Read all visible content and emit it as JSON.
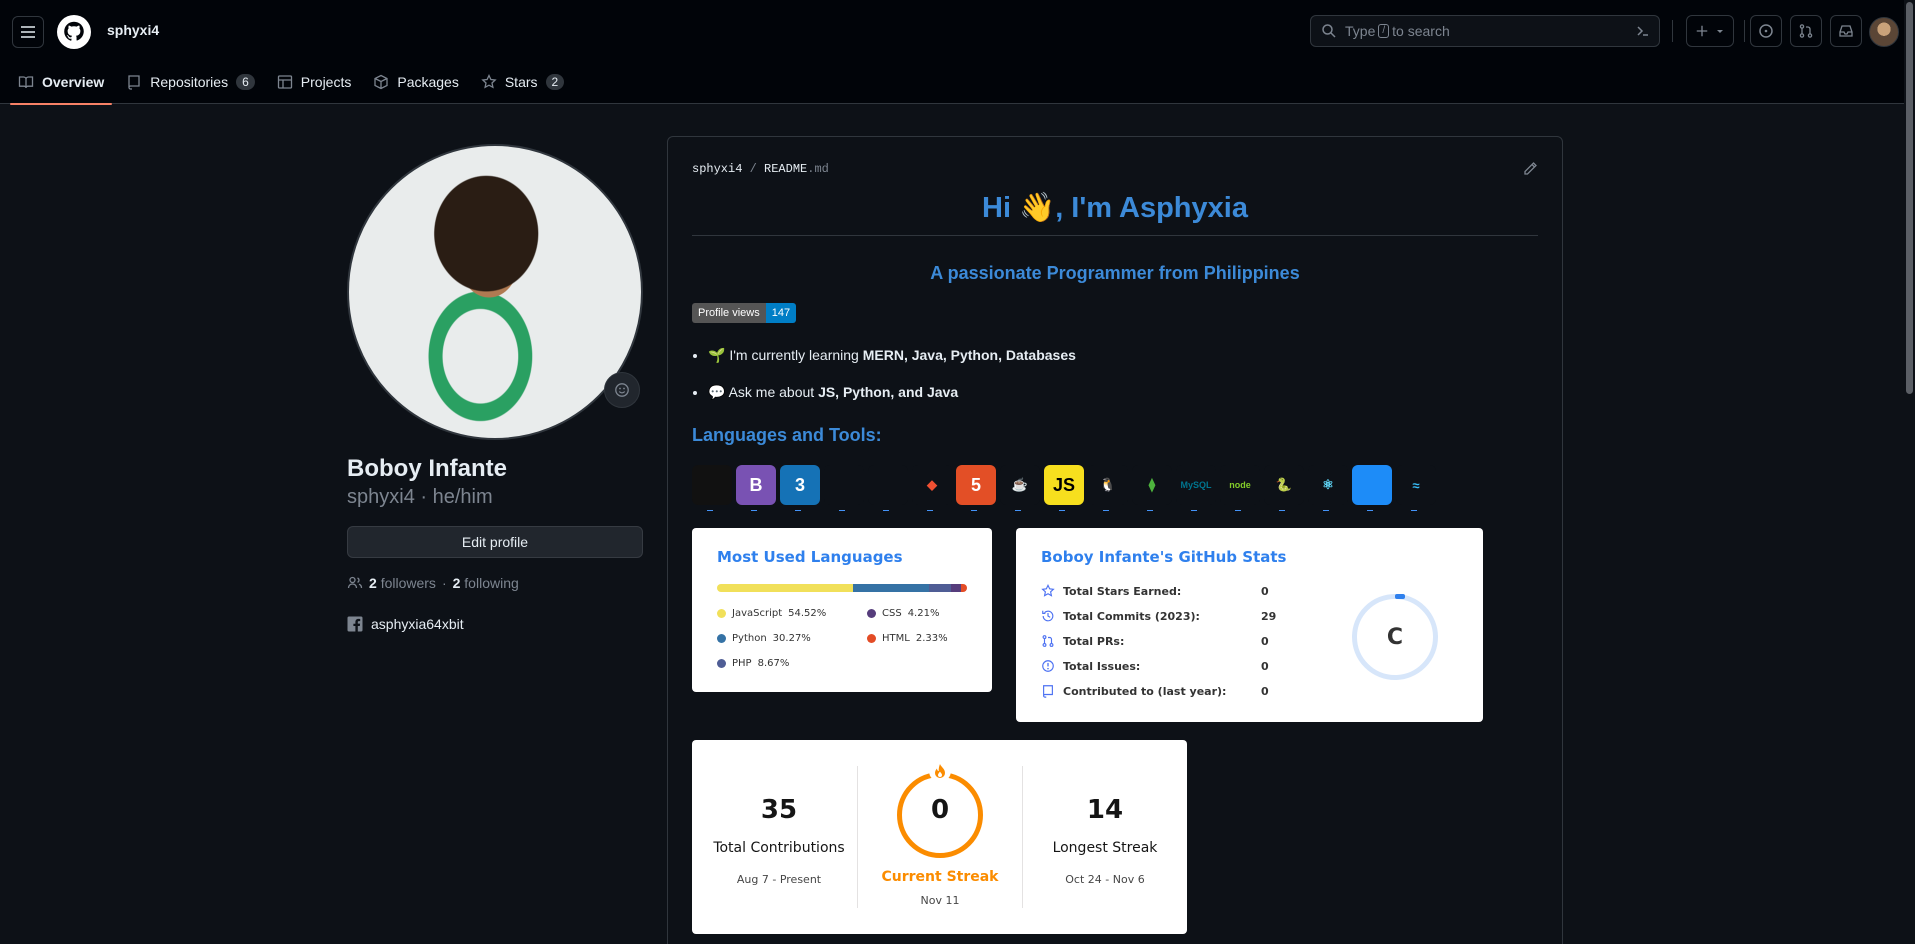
{
  "header": {
    "username": "sphyxi4",
    "search_prefix": "Type",
    "search_key": "/",
    "search_suffix": "to search"
  },
  "tabs": [
    {
      "label": "Overview",
      "icon": "book-icon",
      "selected": true
    },
    {
      "label": "Repositories",
      "icon": "repo-icon",
      "count": "6"
    },
    {
      "label": "Projects",
      "icon": "table-icon"
    },
    {
      "label": "Packages",
      "icon": "package-icon"
    },
    {
      "label": "Stars",
      "icon": "star-icon",
      "count": "2"
    }
  ],
  "profile": {
    "name": "Boboy Infante",
    "login": "sphyxi4",
    "separator": "·",
    "pronouns": "he/him",
    "edit_label": "Edit profile",
    "followers_count": "2",
    "followers_label": "followers",
    "following_count": "2",
    "following_label": "following",
    "facebook": "asphyxia64xbit"
  },
  "readme": {
    "owner": "sphyxi4",
    "path_sep": "/",
    "file_name": "README",
    "file_ext": ".md",
    "heading_prefix": "Hi",
    "heading_suffix": ", I'm Asphyxia",
    "subheading": "A passionate Programmer from Philippines",
    "badge_label": "Profile views",
    "badge_value": "147",
    "bullet1_prefix": "I'm currently learning ",
    "bullet1_bold": "MERN, Java, Python, Databases",
    "bullet2_prefix": "Ask me about ",
    "bullet2_bold": "JS, Python, and Java",
    "tools_heading": "Languages and Tools:",
    "tools": [
      {
        "name": "aws",
        "text": "",
        "bg": "#111111",
        "fg": "#333333"
      },
      {
        "name": "bootstrap",
        "text": "B",
        "bg": "#7952b3",
        "fg": "#ffffff"
      },
      {
        "name": "css3",
        "text": "3",
        "bg": "#1572b6",
        "fg": "#ffffff"
      },
      {
        "name": "express",
        "text": "",
        "bg": "#0d1117",
        "fg": "#222222"
      },
      {
        "name": "flask",
        "text": "",
        "bg": "#0d1117",
        "fg": "#222222"
      },
      {
        "name": "git",
        "text": "◆",
        "bg": "#0d1117",
        "fg": "#f05032"
      },
      {
        "name": "html5",
        "text": "5",
        "bg": "#e34f26",
        "fg": "#ffffff"
      },
      {
        "name": "java",
        "text": "☕",
        "bg": "#0d1117",
        "fg": "#e76f00"
      },
      {
        "name": "javascript",
        "text": "JS",
        "bg": "#f7df1e",
        "fg": "#000000"
      },
      {
        "name": "linux",
        "text": "🐧",
        "bg": "#0d1117",
        "fg": "#ffffff"
      },
      {
        "name": "mongodb",
        "text": "⧫",
        "bg": "#0d1117",
        "fg": "#4db33d"
      },
      {
        "name": "mysql",
        "text": "MySQL",
        "bg": "#0d1117",
        "fg": "#00758f"
      },
      {
        "name": "nodejs",
        "text": "node",
        "bg": "#0d1117",
        "fg": "#83cd29"
      },
      {
        "name": "python",
        "text": "🐍",
        "bg": "#0d1117",
        "fg": "#3776ab"
      },
      {
        "name": "react",
        "text": "⚛",
        "bg": "#0d1117",
        "fg": "#61dafb"
      },
      {
        "name": "swift",
        "text": "",
        "bg": "#1d8cf8",
        "fg": "#ffffff"
      },
      {
        "name": "tailwind",
        "text": "≈",
        "bg": "#0d1117",
        "fg": "#38bdf8"
      }
    ]
  },
  "languages_card": {
    "title": "Most Used Languages",
    "items": [
      {
        "name": "JavaScript",
        "pct": "54.52%",
        "value": 54.52,
        "color": "#f1e05a"
      },
      {
        "name": "Python",
        "pct": "30.27%",
        "value": 30.27,
        "color": "#3572A5"
      },
      {
        "name": "PHP",
        "pct": "8.67%",
        "value": 8.67,
        "color": "#4F5D95"
      },
      {
        "name": "CSS",
        "pct": "4.21%",
        "value": 4.21,
        "color": "#563d7c"
      },
      {
        "name": "HTML",
        "pct": "2.33%",
        "value": 2.33,
        "color": "#e34c26"
      }
    ]
  },
  "stats_card": {
    "title": "Boboy Infante's GitHub Stats",
    "rows": [
      {
        "icon": "star-icon",
        "label": "Total Stars Earned:",
        "value": "0"
      },
      {
        "icon": "history-icon",
        "label": "Total Commits (2023):",
        "value": "29"
      },
      {
        "icon": "pr-icon",
        "label": "Total PRs:",
        "value": "0"
      },
      {
        "icon": "issue-icon",
        "label": "Total Issues:",
        "value": "0"
      },
      {
        "icon": "repo-icon",
        "label": "Contributed to (last year):",
        "value": "0"
      }
    ],
    "rank": "C"
  },
  "streak_card": {
    "total": "35",
    "total_label": "Total Contributions",
    "total_range": "Aug 7 - Present",
    "current": "0",
    "current_label": "Current Streak",
    "current_range": "Nov 11",
    "longest": "14",
    "longest_label": "Longest Streak",
    "longest_range": "Oct 24 - Nov 6"
  },
  "colors": {
    "accent": "#3c8ad8",
    "tab_underline": "#f78166",
    "streak_orange": "#fb8c00"
  }
}
